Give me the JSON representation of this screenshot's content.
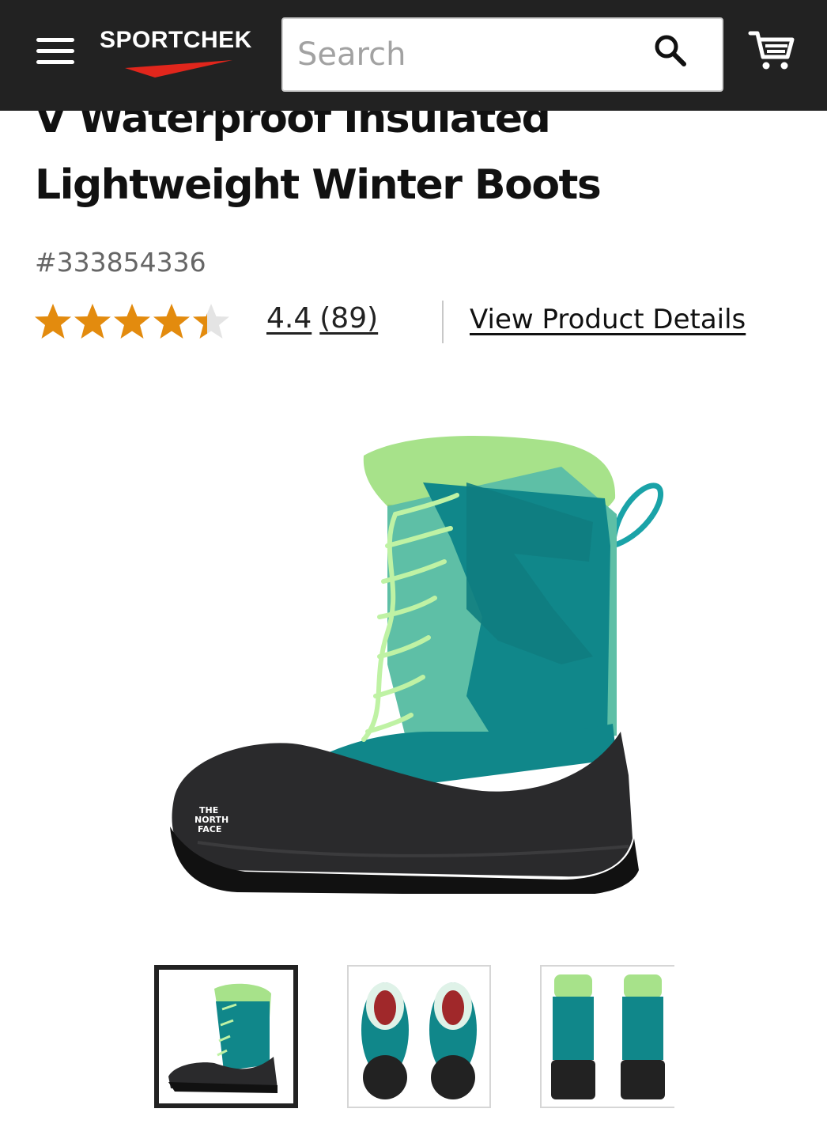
{
  "header": {
    "brand": "SPORTCHEK",
    "search_placeholder": "Search",
    "colors": {
      "background": "#222222",
      "brand_accent": "#e1261c"
    }
  },
  "product": {
    "title_lines": [
      "V Waterproof Insulated",
      "Lightweight Winter Boots"
    ],
    "sku": "#333854336",
    "rating_value": "4.4",
    "review_count": "(89)",
    "rating_stars": 4.4,
    "star_color": "#e38b0e",
    "details_link": "View Product Details"
  },
  "gallery": {
    "main_image": "winter-boot-side-view",
    "thumbnails": [
      {
        "name": "boot-side-thumbnail",
        "selected": true
      },
      {
        "name": "boots-top-thumbnail",
        "selected": false
      },
      {
        "name": "boots-back-thumbnail",
        "selected": false
      }
    ]
  }
}
